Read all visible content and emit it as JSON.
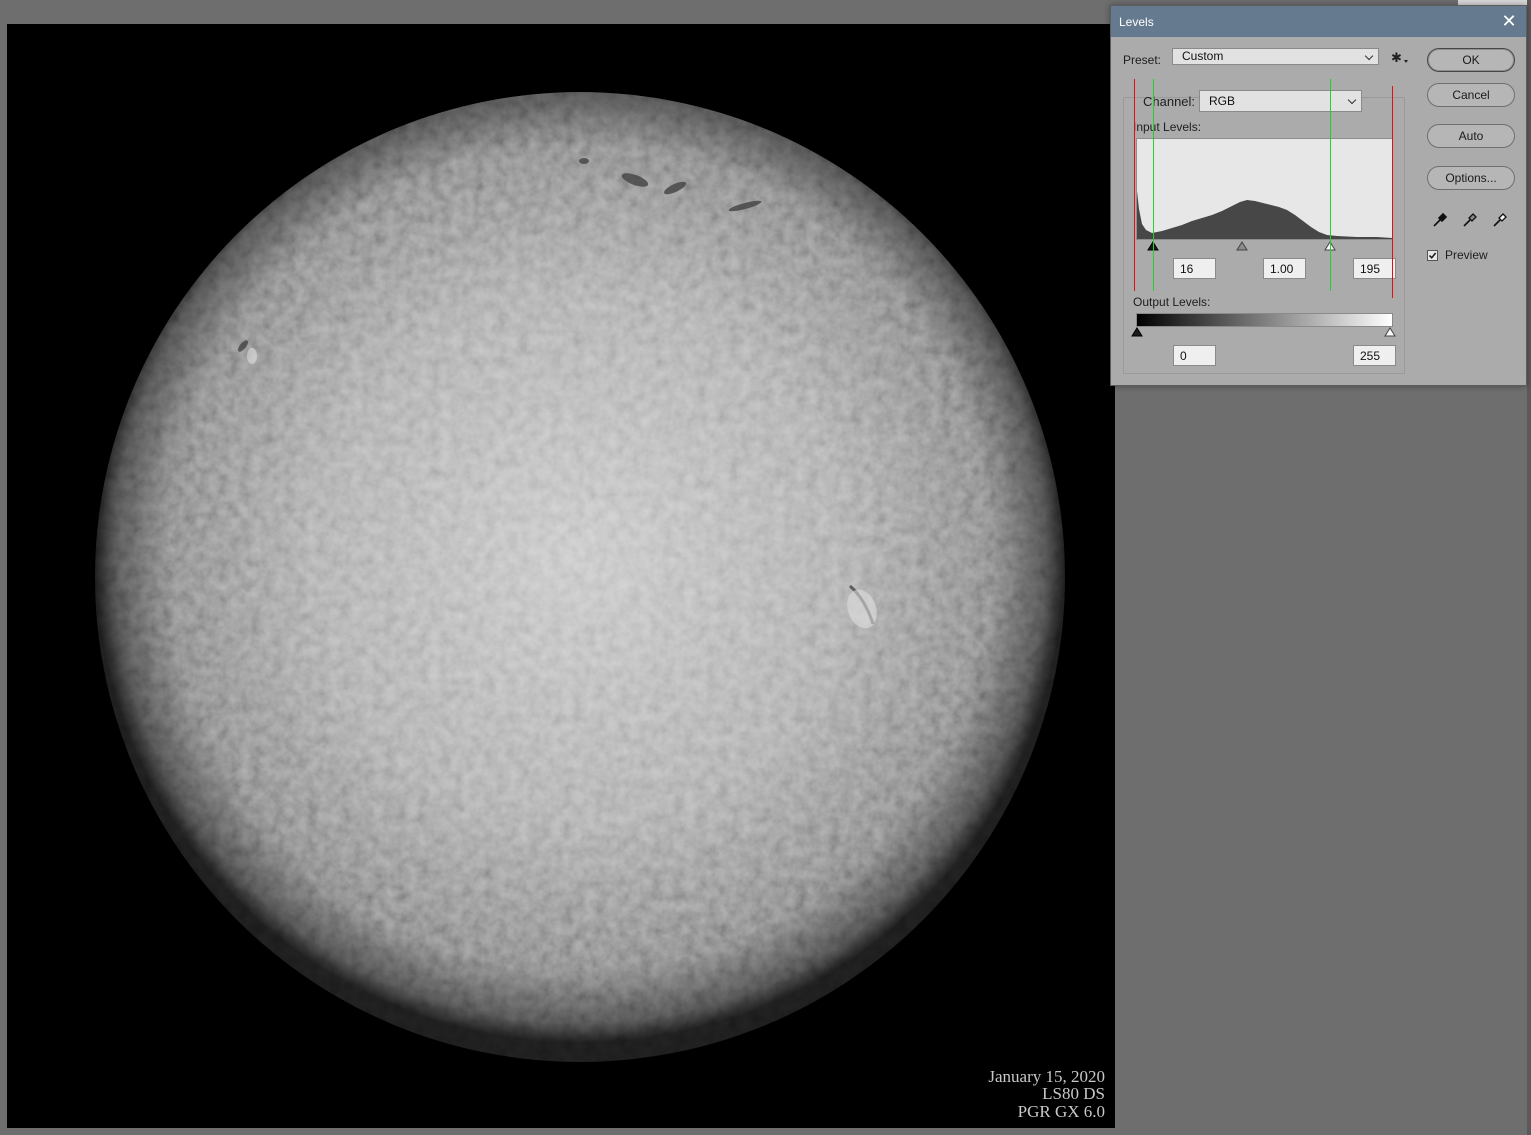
{
  "canvas": {
    "caption": [
      "January 15, 2020",
      "LS80 DS",
      "PGR GX 6.0"
    ]
  },
  "levels_dialog": {
    "title": "Levels",
    "preset_label": "Preset:",
    "preset_value": "Custom",
    "channel_label": "Channel:",
    "channel_value": "RGB",
    "input_levels_label": "Input Levels:",
    "input_black": "16",
    "input_gamma": "1.00",
    "input_white": "195",
    "output_levels_label": "Output Levels:",
    "output_black": "0",
    "output_white": "255",
    "buttons": {
      "ok": "OK",
      "cancel": "Cancel",
      "auto": "Auto",
      "options": "Options..."
    },
    "preview_label": "Preview",
    "preview_checked": true,
    "icons": [
      "gear-icon",
      "close-icon",
      "black-eyedropper-icon",
      "gray-eyedropper-icon",
      "white-eyedropper-icon"
    ],
    "colors": {
      "titlebar": "#667a8f",
      "dialog_bg": "#ababab",
      "histogram_fill": "#474747",
      "guide_red": "#e01010",
      "guide_green": "#22d22a"
    }
  }
}
